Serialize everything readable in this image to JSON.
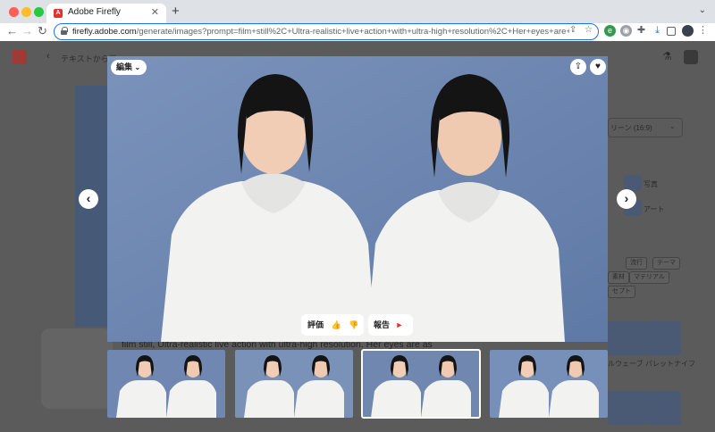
{
  "browser": {
    "tab_title": "Adobe Firefly",
    "tab_favicon_letter": "A",
    "tab_close": "✕",
    "new_tab": "+",
    "url_host": "firefly.adobe.com",
    "url_path": "/generate/images?prompt=film+still%2C+Ultra-realistic+live+action+with+ultra-high+resolution%2C+Her+eyes+are+as+beautiful+a..."
  },
  "page": {
    "breadcrumb": "テキストから画",
    "prompt_snippet": "film still, Ultra-realistic live action with ultra-high resolution. Her eyes are as",
    "aspect_ratio": "リーン (16:9)",
    "side_labels": [
      "写真",
      "アート"
    ],
    "style_chips": [
      "流行",
      "テーマ",
      "素材",
      "マテリアル",
      "セプト"
    ],
    "style_thumb_labels": [
      "ルウェーブ",
      "パレットナイフ"
    ]
  },
  "modal": {
    "edit_label": "編集",
    "rate_label": "評価",
    "report_label": "報告",
    "colors": {
      "accent": "#e4312b",
      "image_bg": "#7088b0",
      "hoodie": "#f2f2f0"
    },
    "icons": [
      "share-icon",
      "heart-icon",
      "chevron-left-icon",
      "chevron-right-icon",
      "thumbs-up-icon",
      "thumbs-down-icon",
      "flag-icon"
    ],
    "thumbnails": [
      {
        "selected": false
      },
      {
        "selected": false
      },
      {
        "selected": true
      },
      {
        "selected": false
      }
    ]
  }
}
